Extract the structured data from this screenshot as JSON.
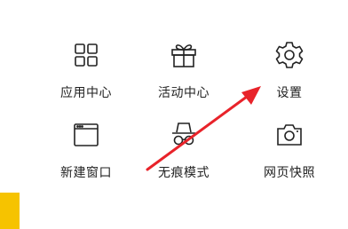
{
  "menu": {
    "items": [
      {
        "label": "应用中心",
        "icon": "apps-grid-icon"
      },
      {
        "label": "活动中心",
        "icon": "gift-icon"
      },
      {
        "label": "设置",
        "icon": "gear-icon"
      },
      {
        "label": "新建窗口",
        "icon": "new-window-icon"
      },
      {
        "label": "无痕模式",
        "icon": "incognito-icon"
      },
      {
        "label": "网页快照",
        "icon": "camera-icon"
      }
    ]
  },
  "colors": {
    "arrow": "#e8232a",
    "accent": "#f6c300",
    "icon_stroke": "#222222"
  }
}
